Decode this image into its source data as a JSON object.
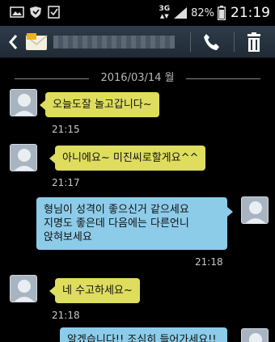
{
  "status_bar": {
    "network": "3G",
    "battery": "82%",
    "time": "21:19"
  },
  "date_separator": "2016/03/14 월",
  "messages": [
    {
      "direction": "in",
      "text": "오늘도잘 놀고갑니다~",
      "time": "21:15"
    },
    {
      "direction": "in",
      "text": "아니에요~ 미진씨로할게요^^",
      "time": "21:17"
    },
    {
      "direction": "out",
      "lines": [
        "형님이 성격이 좋으신거 같으세요",
        "지명도 좋은데 다음에는 다른언니",
        "앉혀보세요"
      ],
      "time": "21:18"
    },
    {
      "direction": "in",
      "text": "네 수고하세요~",
      "time": "21:18"
    },
    {
      "direction": "out",
      "text": "알겠습니다!! 조심히 들어가세요!!"
    }
  ]
}
